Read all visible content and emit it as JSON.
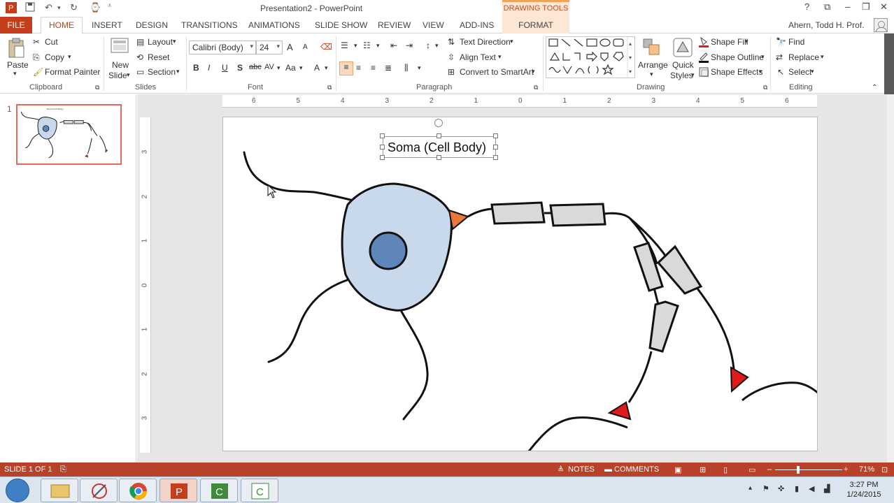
{
  "window": {
    "title": "Presentation2 - PowerPoint",
    "context_tab_header": "DRAWING TOOLS",
    "user": "Ahern, Todd H. Prof."
  },
  "tabs": {
    "file": "FILE",
    "home": "HOME",
    "insert": "INSERT",
    "design": "DESIGN",
    "transitions": "TRANSITIONS",
    "animations": "ANIMATIONS",
    "slideshow": "SLIDE SHOW",
    "review": "REVIEW",
    "view": "VIEW",
    "addins": "ADD-INS",
    "format": "FORMAT"
  },
  "ribbon": {
    "clipboard": {
      "paste": "Paste",
      "cut": "Cut",
      "copy": "Copy",
      "format_painter": "Format Painter",
      "label": "Clipboard"
    },
    "slides": {
      "new_slide_1": "New",
      "new_slide_2": "Slide",
      "layout": "Layout",
      "reset": "Reset",
      "section": "Section",
      "label": "Slides"
    },
    "font": {
      "family": "Calibri (Body)",
      "size": "24",
      "bold": "B",
      "italic": "I",
      "underline": "U",
      "shadow": "S",
      "strike": "abc",
      "spacing": "AV",
      "case": "Aa",
      "color": "A",
      "grow": "A",
      "shrink": "A",
      "label": "Font"
    },
    "paragraph": {
      "text_direction": "Text Direction",
      "align_text": "Align Text",
      "convert_smartart": "Convert to SmartArt",
      "label": "Paragraph"
    },
    "drawing": {
      "arrange": "Arrange",
      "quick_styles_1": "Quick",
      "quick_styles_2": "Styles",
      "shape_fill": "Shape Fill",
      "shape_outline": "Shape Outline",
      "shape_effects": "Shape Effects",
      "label": "Drawing"
    },
    "editing": {
      "find": "Find",
      "replace": "Replace",
      "select": "Select",
      "label": "Editing"
    }
  },
  "thumbnails": [
    {
      "number": "1"
    }
  ],
  "slide": {
    "textbox_text": "Soma (Cell Body)"
  },
  "rulers": {
    "horizontal": [
      "6",
      "5",
      "4",
      "3",
      "2",
      "1",
      "0",
      "1",
      "2",
      "3",
      "4",
      "5",
      "6"
    ],
    "vertical": [
      "3",
      "2",
      "1",
      "0",
      "1",
      "2",
      "3"
    ]
  },
  "statusbar": {
    "slide_info": "SLIDE 1 OF 1",
    "notes": "NOTES",
    "comments": "COMMENTS",
    "zoom": "71%"
  },
  "taskbar": {
    "time": "3:27 PM",
    "date": "1/24/2015"
  },
  "colors": {
    "accent": "#c43e1c",
    "statusbar": "#b8412a",
    "soma_fill": "#c9d9ec",
    "nucleus_fill": "#5f86b9",
    "myelin_fill": "#d9d9d9",
    "axon_hillock": "#e8773a",
    "terminal": "#e01b1b"
  }
}
